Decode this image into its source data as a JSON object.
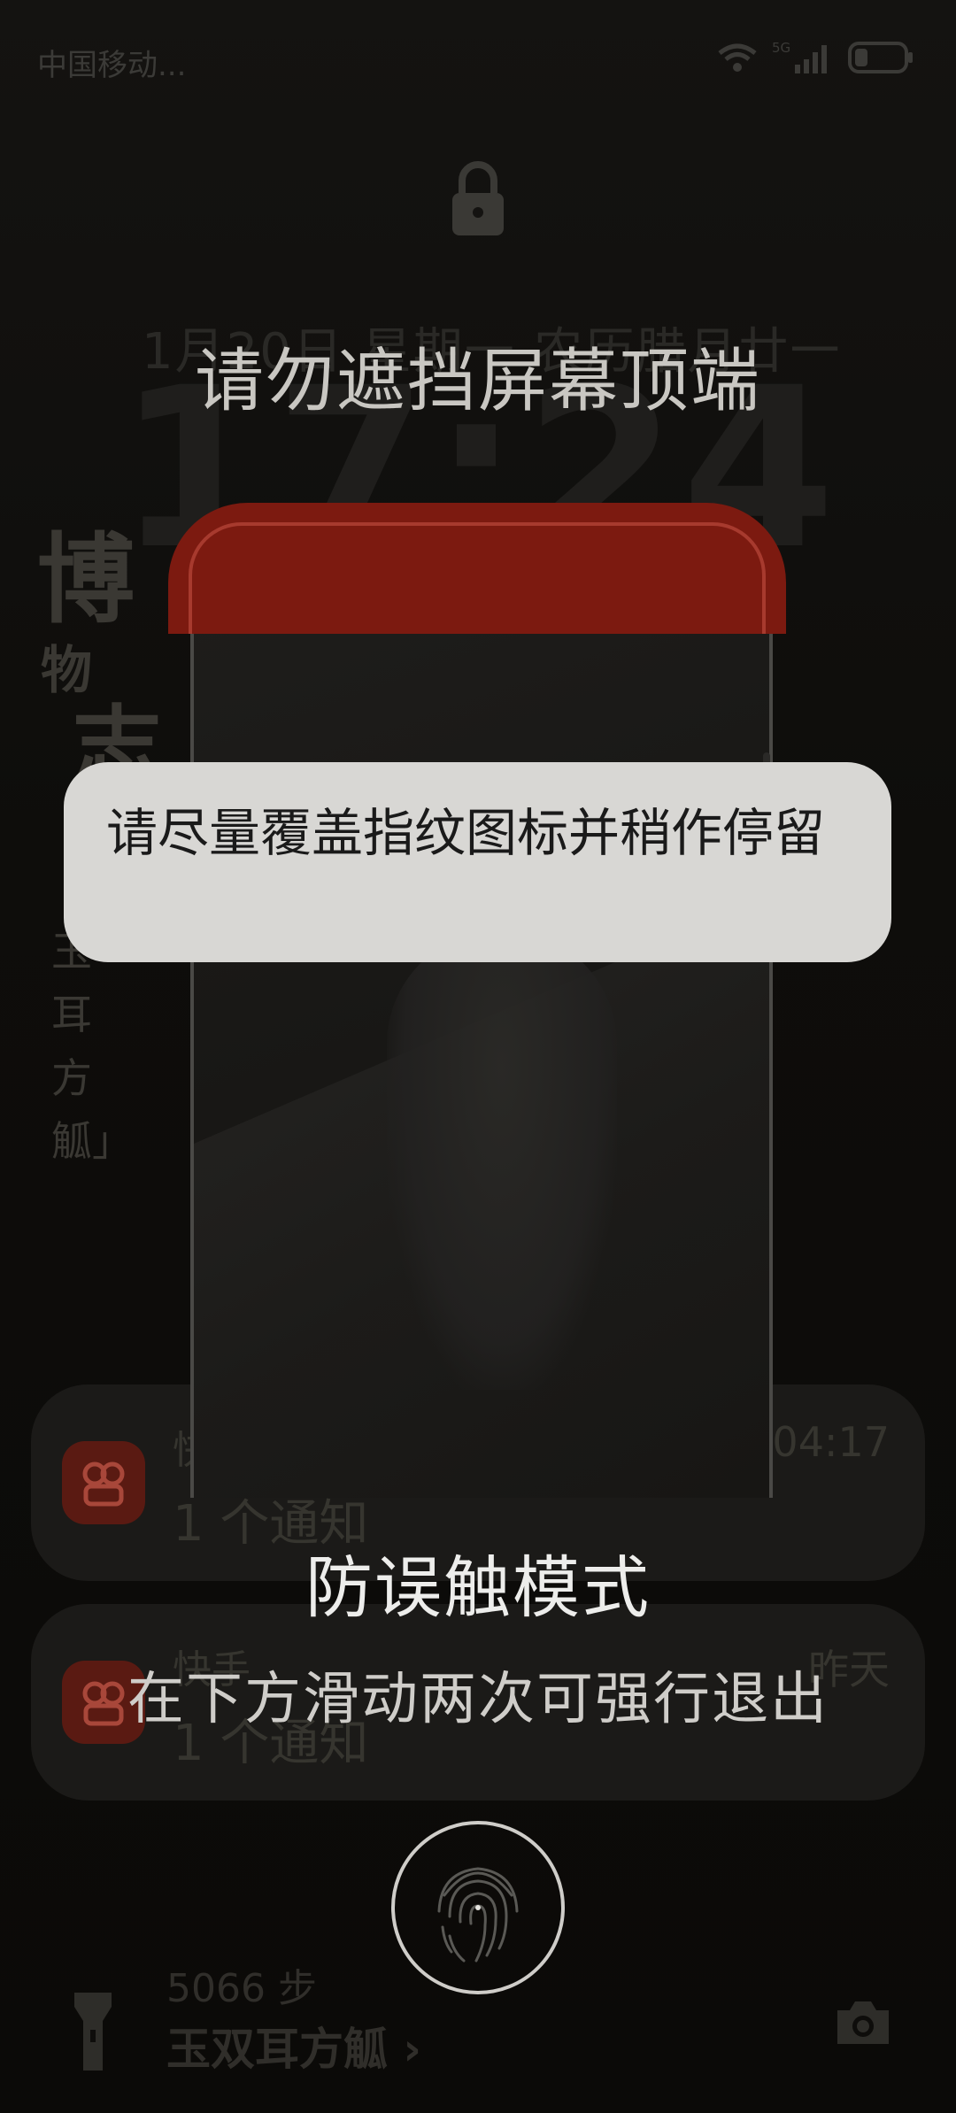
{
  "status_bar": {
    "carrier": "中国移动...",
    "network": "5G"
  },
  "lockscreen": {
    "date": "1月20日 星期一 农历腊月廿一",
    "clock": "17:24",
    "calligraphy": {
      "line1": "博",
      "line2": "物",
      "line3": "志",
      "vertical": "玉耳方觚」"
    },
    "notifications": [
      {
        "app": "快手",
        "time": "04:17",
        "text": "1 个通知"
      },
      {
        "app": "快手",
        "time": "昨天",
        "text": "1 个通知"
      }
    ],
    "steps": "5066 步",
    "place": "玉双耳方觚 ›"
  },
  "overlay": {
    "warning": "请勿遮挡屏幕顶端",
    "tip": "请尽量覆盖指纹图标并稍作停留",
    "mode_title": "防误触模式",
    "mode_hint": "在下方滑动两次可强行退出"
  },
  "colors": {
    "accent_red": "#7c1a10",
    "bubble": "#d8d7d4",
    "app_icon": "#5a1a12"
  }
}
